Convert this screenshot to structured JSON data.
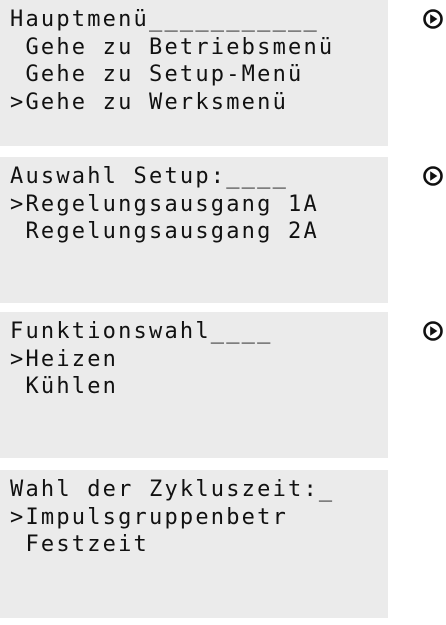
{
  "screens": [
    {
      "name": "hauptmenue",
      "lines": [
        "Hauptmenü___________",
        " Gehe zu Betriebsmenü",
        " Gehe zu Setup-Menü",
        ">Gehe zu Werksmenü"
      ],
      "icon": "arrow-right-circle-icon"
    },
    {
      "name": "auswahl-setup",
      "lines": [
        "Auswahl Setup:____",
        ">Regelungsausgang 1A",
        " Regelungsausgang 2A",
        ""
      ],
      "icon": "arrow-right-circle-icon"
    },
    {
      "name": "funktionswahl",
      "lines": [
        "Funktionswahl____",
        ">Heizen",
        " Kühlen",
        ""
      ],
      "icon": "arrow-right-circle-icon"
    },
    {
      "name": "zykluszeit",
      "lines": [
        "Wahl der Zykluszeit:_",
        ">Impulsgruppenbetr",
        " Festzeit",
        ""
      ],
      "icon": null
    }
  ]
}
